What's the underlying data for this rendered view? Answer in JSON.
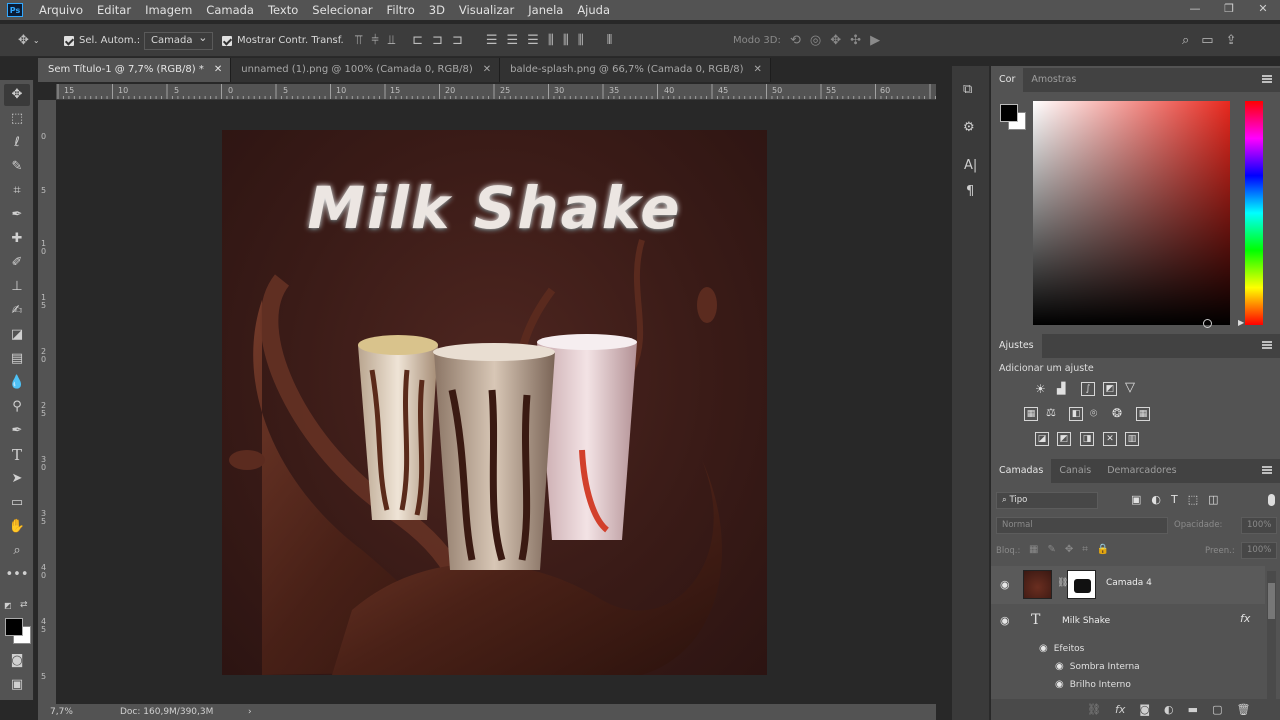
{
  "app": {
    "logo": "Ps"
  },
  "menu": [
    "Arquivo",
    "Editar",
    "Imagem",
    "Camada",
    "Texto",
    "Selecionar",
    "Filtro",
    "3D",
    "Visualizar",
    "Janela",
    "Ajuda"
  ],
  "options": {
    "auto_select_label": "Sel. Autom.:",
    "auto_select_value": "Camada",
    "show_transform_label": "Mostrar Contr. Transf.",
    "mode3d_label": "Modo 3D:"
  },
  "tabs": [
    {
      "label": "Sem Título-1 @ 7,7% (RGB/8) *",
      "active": true
    },
    {
      "label": "unnamed (1).png @ 100% (Camada 0, RGB/8)",
      "active": false
    },
    {
      "label": "balde-splash.png @ 66,7% (Camada 0, RGB/8)",
      "active": false
    }
  ],
  "ruler_h": [
    "15",
    "10",
    "5",
    "0",
    "5",
    "10",
    "15",
    "20",
    "25",
    "30",
    "35",
    "40",
    "45",
    "50",
    "55",
    "60"
  ],
  "ruler_v": [
    "0",
    "5",
    "1\n0",
    "1\n5",
    "2\n0",
    "2\n5",
    "3\n0",
    "3\n5",
    "4\n0",
    "4\n5",
    "5"
  ],
  "artwork": {
    "title": "Milk Shake"
  },
  "status": {
    "zoom": "7,7%",
    "doc": "Doc: 160,9M/390,3M"
  },
  "color_panel": {
    "tabs": [
      "Cor",
      "Amostras"
    ],
    "fg": "#000000",
    "bg": "#ffffff",
    "picker_hue": "#e8281e"
  },
  "adjustments": {
    "title": "Ajustes",
    "subtitle": "Adicionar um ajuste"
  },
  "layers_panel": {
    "tabs": [
      "Camadas",
      "Canais",
      "Demarcadores"
    ],
    "filter": "Tipo",
    "blend_mode": "Normal",
    "opacity_label": "Opacidade:",
    "opacity_value": "100%",
    "lock_label": "Bloq.:",
    "fill_label": "Preen.:",
    "fill_value": "100%",
    "layers": [
      {
        "name": "Camada 4"
      },
      {
        "name": "Milk Shake",
        "fx": "fx"
      }
    ],
    "effects_label": "Efeitos",
    "effects": [
      "Sombra Interna",
      "Brilho Interno"
    ]
  }
}
